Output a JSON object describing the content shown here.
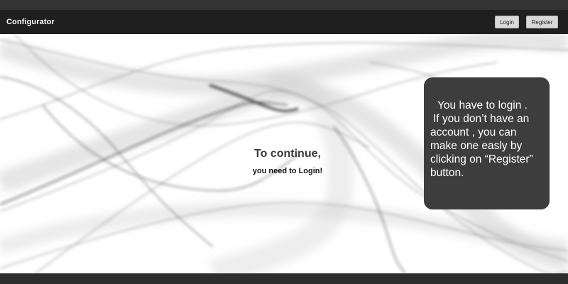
{
  "navbar": {
    "brand": "Configurator",
    "login_label": "Login",
    "register_label": "Register"
  },
  "main": {
    "title": "To continue,",
    "subtitle": "you need to Login!"
  },
  "info_box": {
    "lines": [
      "You have to login .",
      "If you don’t have an",
      "account , you can",
      "make one easly by",
      "clicking on “Register”",
      "button."
    ]
  },
  "colors": {
    "navbar_bg": "#1f1f1f",
    "top_strip": "#333333",
    "button_bg": "#d9d9d9",
    "info_box_bg": "#3d3d3d",
    "hero_bg": "#ffffff"
  }
}
